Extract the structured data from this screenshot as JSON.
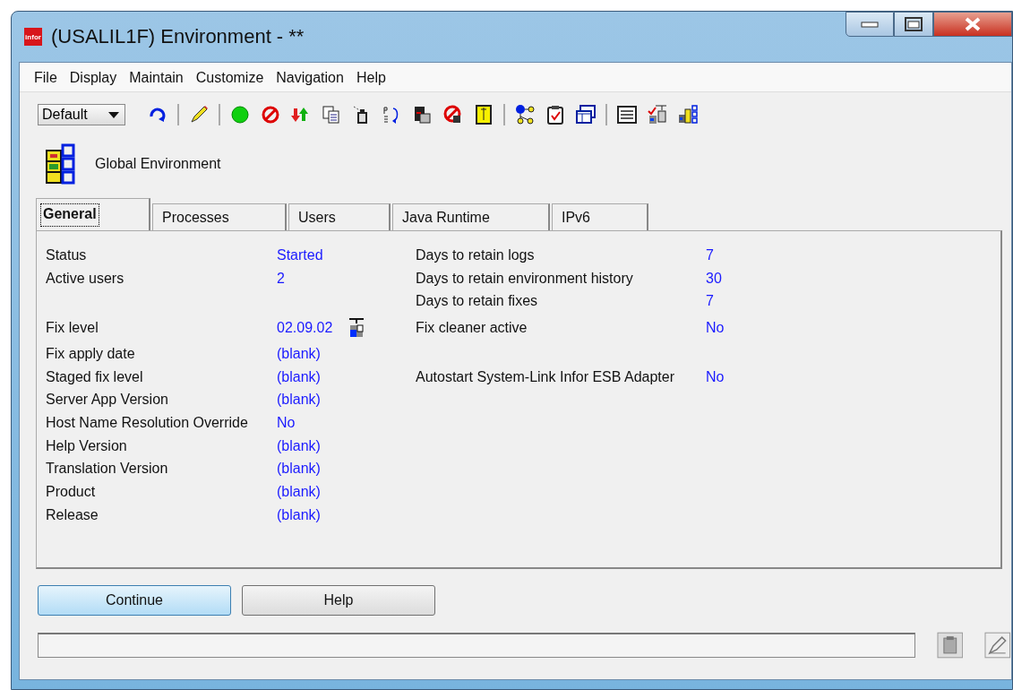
{
  "window": {
    "logo": "infor",
    "title": "(USALIL1F) Environment - **"
  },
  "menu": [
    "File",
    "Display",
    "Maintain",
    "Customize",
    "Navigation",
    "Help"
  ],
  "toolbar": {
    "view_select": {
      "value": "Default"
    }
  },
  "header": {
    "title": "Global Environment"
  },
  "tabs": [
    {
      "label": "General",
      "selected": true
    },
    {
      "label": "Processes",
      "selected": false
    },
    {
      "label": "Users",
      "selected": false
    },
    {
      "label": "Java Runtime",
      "selected": false
    },
    {
      "label": "IPv6",
      "selected": false
    }
  ],
  "rows": [
    {
      "left": {
        "label": "Status",
        "value": "Started"
      },
      "right": {
        "label": "Days to retain logs",
        "value": "7"
      }
    },
    {
      "left": {
        "label": "Active users",
        "value": "2"
      },
      "right": {
        "label": "Days to retain environment history",
        "value": "30"
      }
    },
    {
      "right": {
        "label": "Days to retain fixes",
        "value": "7"
      }
    },
    {
      "left": {
        "label": "Fix level",
        "value": "02.09.02",
        "kind": "with-icon"
      },
      "right": {
        "label": "Fix cleaner active",
        "value": "No"
      }
    },
    {
      "left": {
        "label": "Fix apply date",
        "value": "(blank)"
      }
    },
    {
      "left": {
        "label": "Staged fix level",
        "value": "(blank)"
      },
      "right": {
        "label": "Autostart System-Link Infor ESB Adapter",
        "value": "No"
      }
    },
    {
      "left": {
        "label": "Server App Version",
        "value": "(blank)"
      }
    },
    {
      "left": {
        "label": "Host Name Resolution Override",
        "value": "No"
      }
    },
    {
      "left": {
        "label": "Help Version",
        "value": "(blank)"
      }
    },
    {
      "left": {
        "label": "Translation  Version",
        "value": "(blank)"
      }
    },
    {
      "left": {
        "label": "Product",
        "value": "(blank)"
      }
    },
    {
      "left": {
        "label": "Release",
        "value": "(blank)"
      }
    }
  ],
  "buttons": [
    {
      "label": "Continue",
      "kind": "default"
    },
    {
      "label": "Help",
      "kind": "normal"
    }
  ]
}
